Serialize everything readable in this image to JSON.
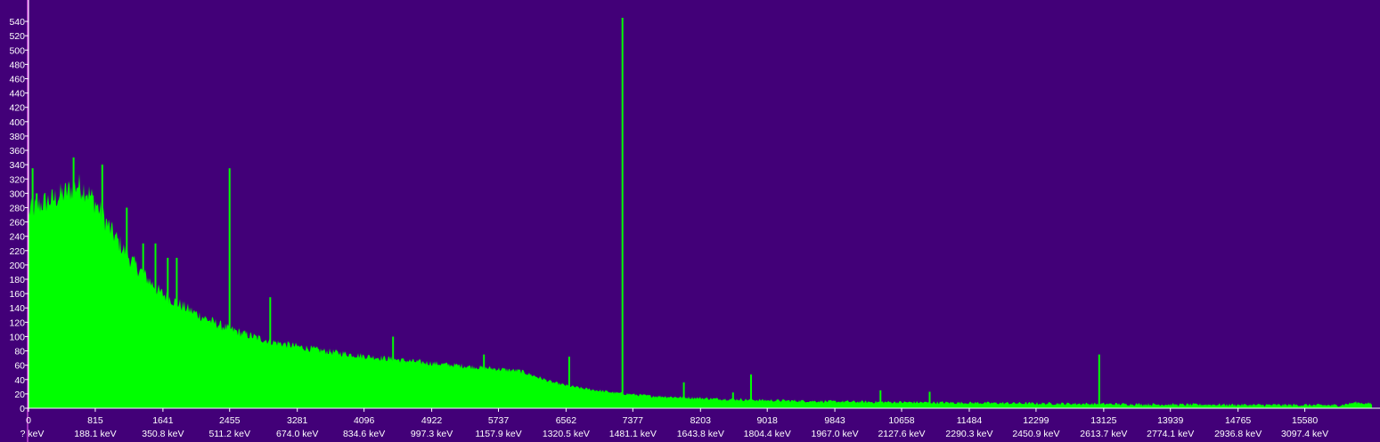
{
  "colors": {
    "background": "#420078",
    "spectrum": "#00ff00",
    "axis": "#ffffff",
    "marker": "#ff66ff"
  },
  "chart_data": {
    "type": "area",
    "title": "",
    "xlabel": "",
    "ylabel": "",
    "xlim": [
      0,
      16400
    ],
    "ylim": [
      0,
      550
    ],
    "grid": false,
    "y_ticks": [
      0,
      20,
      40,
      60,
      80,
      100,
      120,
      140,
      160,
      180,
      200,
      220,
      240,
      260,
      280,
      300,
      320,
      340,
      360,
      380,
      400,
      420,
      440,
      460,
      480,
      500,
      520,
      540
    ],
    "x_ticks": [
      {
        "channel": 0,
        "energy": "? keV"
      },
      {
        "channel": 815,
        "energy": "188.1 keV"
      },
      {
        "channel": 1641,
        "energy": "350.8 keV"
      },
      {
        "channel": 2455,
        "energy": "511.2 keV"
      },
      {
        "channel": 3281,
        "energy": "674.0 keV"
      },
      {
        "channel": 4096,
        "energy": "834.6 keV"
      },
      {
        "channel": 4922,
        "energy": "997.3 keV"
      },
      {
        "channel": 5737,
        "energy": "1157.9 keV"
      },
      {
        "channel": 6562,
        "energy": "1320.5 keV"
      },
      {
        "channel": 7377,
        "energy": "1481.1 keV"
      },
      {
        "channel": 8203,
        "energy": "1643.8 keV"
      },
      {
        "channel": 9018,
        "energy": "1804.4 keV"
      },
      {
        "channel": 9843,
        "energy": "1967.0 keV"
      },
      {
        "channel": 10658,
        "energy": "2127.6 keV"
      },
      {
        "channel": 11484,
        "energy": "2290.3 keV"
      },
      {
        "channel": 12299,
        "energy": "2450.9 keV"
      },
      {
        "channel": 13125,
        "energy": "2613.7 keV"
      },
      {
        "channel": 13939,
        "energy": "2774.1 keV"
      },
      {
        "channel": 14765,
        "energy": "2936.8 keV"
      },
      {
        "channel": 15580,
        "energy": "3097.4 keV"
      }
    ],
    "series": [
      {
        "values_x": [
          0,
          100,
          200,
          300,
          400,
          500,
          600,
          700,
          800,
          900,
          1000,
          1100,
          1200,
          1300,
          1400,
          1500,
          1600,
          1800,
          2000,
          2200,
          2400,
          2600,
          2800,
          3000,
          3300,
          3600,
          4000,
          4400,
          4800,
          5200,
          5600,
          6000,
          6200,
          6400,
          6600,
          6800,
          7000,
          7200,
          7400,
          7600,
          8000,
          8400,
          9000,
          9500,
          10000,
          10500,
          11000,
          11500,
          12000,
          12500,
          13000,
          13500,
          14000,
          14500,
          15000,
          15500,
          16000,
          16200,
          16400
        ],
        "values_y": [
          275,
          282,
          288,
          292,
          298,
          305,
          312,
          305,
          290,
          270,
          250,
          232,
          215,
          200,
          188,
          175,
          162,
          148,
          135,
          123,
          113,
          105,
          98,
          92,
          86,
          80,
          74,
          69,
          64,
          60,
          56,
          52,
          44,
          36,
          31,
          27,
          24,
          21,
          19,
          17,
          15,
          13,
          11,
          10,
          9,
          8.5,
          8,
          7.5,
          7,
          6.5,
          6,
          5.5,
          5,
          5,
          4.5,
          4.5,
          4,
          8,
          6
        ]
      }
    ],
    "peaks": [
      {
        "channel": 50,
        "counts": 335
      },
      {
        "channel": 100,
        "counts": 300
      },
      {
        "channel": 550,
        "counts": 350
      },
      {
        "channel": 900,
        "counts": 340
      },
      {
        "channel": 1200,
        "counts": 280
      },
      {
        "channel": 1400,
        "counts": 230
      },
      {
        "channel": 1550,
        "counts": 230
      },
      {
        "channel": 1700,
        "counts": 210
      },
      {
        "channel": 1810,
        "counts": 210
      },
      {
        "channel": 2455,
        "counts": 335
      },
      {
        "channel": 2950,
        "counts": 155
      },
      {
        "channel": 4450,
        "counts": 100
      },
      {
        "channel": 5560,
        "counts": 75
      },
      {
        "channel": 6600,
        "counts": 72
      },
      {
        "channel": 7251,
        "counts": 545
      },
      {
        "channel": 8000,
        "counts": 36
      },
      {
        "channel": 8600,
        "counts": 22
      },
      {
        "channel": 8820,
        "counts": 47
      },
      {
        "channel": 10400,
        "counts": 25
      },
      {
        "channel": 11000,
        "counts": 23
      },
      {
        "channel": 13070,
        "counts": 75
      }
    ]
  }
}
